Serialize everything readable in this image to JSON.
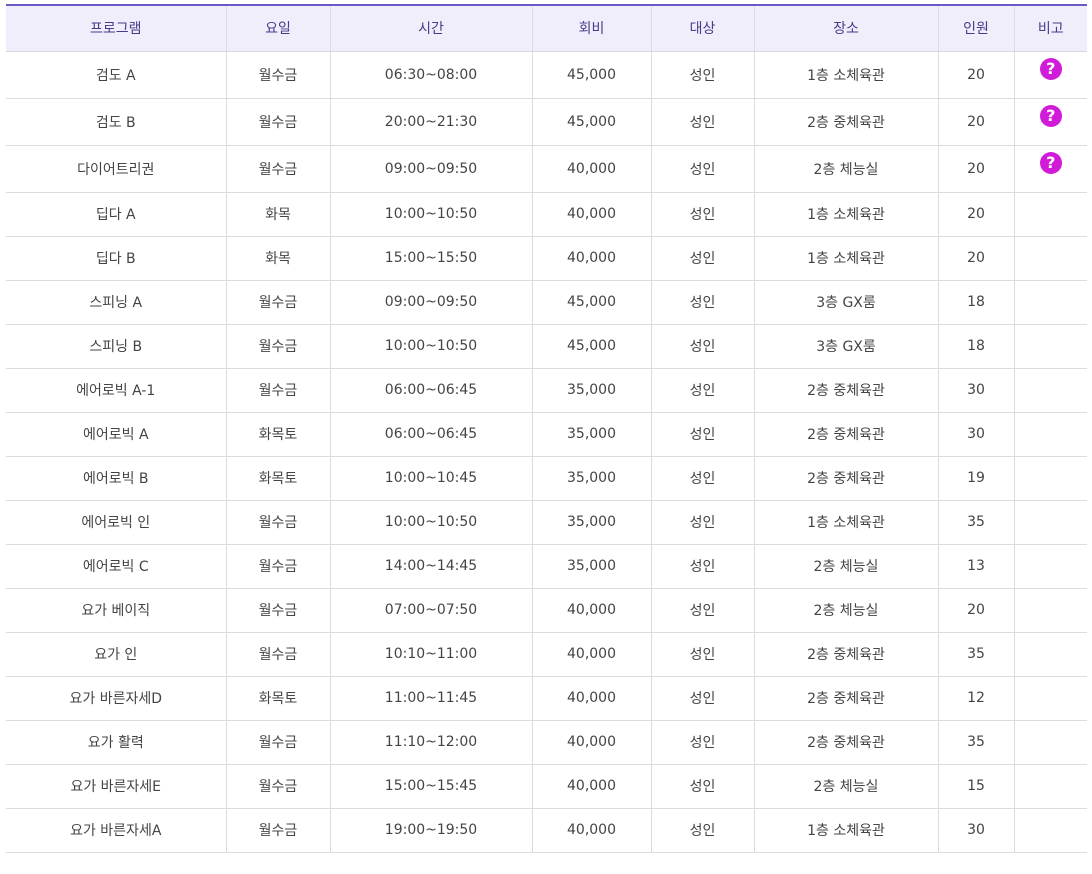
{
  "headers": {
    "program": "프로그램",
    "day": "요일",
    "time": "시간",
    "fee": "회비",
    "target": "대상",
    "place": "장소",
    "capacity": "인원",
    "note": "비고"
  },
  "help_icon_glyph": "?",
  "help_icon_color": "#d21bd9",
  "rows": [
    {
      "program": "검도 A",
      "day": "월수금",
      "time": "06:30~08:00",
      "fee": "45,000",
      "target": "성인",
      "place": "1층 소체육관",
      "capacity": "20",
      "has_help": true
    },
    {
      "program": "검도 B",
      "day": "월수금",
      "time": "20:00~21:30",
      "fee": "45,000",
      "target": "성인",
      "place": "2층 중체육관",
      "capacity": "20",
      "has_help": true
    },
    {
      "program": "다이어트리권",
      "day": "월수금",
      "time": "09:00~09:50",
      "fee": "40,000",
      "target": "성인",
      "place": "2층 체능실",
      "capacity": "20",
      "has_help": true
    },
    {
      "program": "딥다 A",
      "day": "화목",
      "time": "10:00~10:50",
      "fee": "40,000",
      "target": "성인",
      "place": "1층 소체육관",
      "capacity": "20",
      "has_help": false
    },
    {
      "program": "딥다 B",
      "day": "화목",
      "time": "15:00~15:50",
      "fee": "40,000",
      "target": "성인",
      "place": "1층 소체육관",
      "capacity": "20",
      "has_help": false
    },
    {
      "program": "스피닝 A",
      "day": "월수금",
      "time": "09:00~09:50",
      "fee": "45,000",
      "target": "성인",
      "place": "3층 GX룸",
      "capacity": "18",
      "has_help": false
    },
    {
      "program": "스피닝 B",
      "day": "월수금",
      "time": "10:00~10:50",
      "fee": "45,000",
      "target": "성인",
      "place": "3층 GX룸",
      "capacity": "18",
      "has_help": false
    },
    {
      "program": "에어로빅 A-1",
      "day": "월수금",
      "time": "06:00~06:45",
      "fee": "35,000",
      "target": "성인",
      "place": "2층 중체육관",
      "capacity": "30",
      "has_help": false
    },
    {
      "program": "에어로빅 A",
      "day": "화목토",
      "time": "06:00~06:45",
      "fee": "35,000",
      "target": "성인",
      "place": "2층 중체육관",
      "capacity": "30",
      "has_help": false
    },
    {
      "program": "에어로빅 B",
      "day": "화목토",
      "time": "10:00~10:45",
      "fee": "35,000",
      "target": "성인",
      "place": "2층 중체육관",
      "capacity": "19",
      "has_help": false
    },
    {
      "program": "에어로빅 인",
      "day": "월수금",
      "time": "10:00~10:50",
      "fee": "35,000",
      "target": "성인",
      "place": "1층 소체육관",
      "capacity": "35",
      "has_help": false
    },
    {
      "program": "에어로빅 C",
      "day": "월수금",
      "time": "14:00~14:45",
      "fee": "35,000",
      "target": "성인",
      "place": "2층 체능실",
      "capacity": "13",
      "has_help": false
    },
    {
      "program": "요가 베이직",
      "day": "월수금",
      "time": "07:00~07:50",
      "fee": "40,000",
      "target": "성인",
      "place": "2층 체능실",
      "capacity": "20",
      "has_help": false
    },
    {
      "program": "요가 인",
      "day": "월수금",
      "time": "10:10~11:00",
      "fee": "40,000",
      "target": "성인",
      "place": "2층 중체육관",
      "capacity": "35",
      "has_help": false
    },
    {
      "program": "요가 바른자세D",
      "day": "화목토",
      "time": "11:00~11:45",
      "fee": "40,000",
      "target": "성인",
      "place": "2층 중체육관",
      "capacity": "12",
      "has_help": false
    },
    {
      "program": "요가 활력",
      "day": "월수금",
      "time": "11:10~12:00",
      "fee": "40,000",
      "target": "성인",
      "place": "2층 중체육관",
      "capacity": "35",
      "has_help": false
    },
    {
      "program": "요가 바른자세E",
      "day": "월수금",
      "time": "15:00~15:45",
      "fee": "40,000",
      "target": "성인",
      "place": "2층 체능실",
      "capacity": "15",
      "has_help": false
    },
    {
      "program": "요가 바른자세A",
      "day": "월수금",
      "time": "19:00~19:50",
      "fee": "40,000",
      "target": "성인",
      "place": "1층 소체육관",
      "capacity": "30",
      "has_help": false
    }
  ]
}
